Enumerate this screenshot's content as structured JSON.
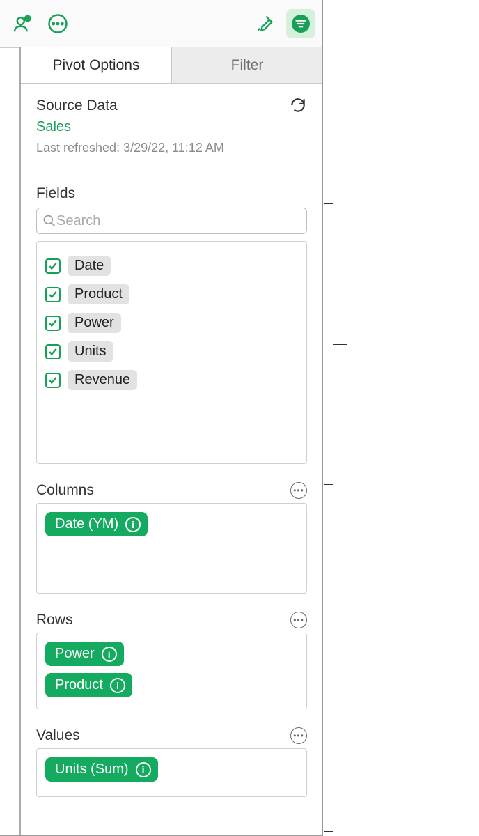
{
  "tabs": {
    "pivot": "Pivot Options",
    "filter": "Filter"
  },
  "source": {
    "heading": "Source Data",
    "name": "Sales",
    "refreshed": "Last refreshed: 3/29/22, 11:12 AM"
  },
  "fields": {
    "heading": "Fields",
    "search_placeholder": "Search",
    "items": [
      {
        "label": "Date",
        "checked": true
      },
      {
        "label": "Product",
        "checked": true
      },
      {
        "label": "Power",
        "checked": true
      },
      {
        "label": "Units",
        "checked": true
      },
      {
        "label": "Revenue",
        "checked": true
      }
    ]
  },
  "columns": {
    "heading": "Columns",
    "items": [
      "Date (YM)"
    ]
  },
  "rows": {
    "heading": "Rows",
    "items": [
      "Power",
      "Product"
    ]
  },
  "values": {
    "heading": "Values",
    "items": [
      "Units (Sum)"
    ]
  }
}
